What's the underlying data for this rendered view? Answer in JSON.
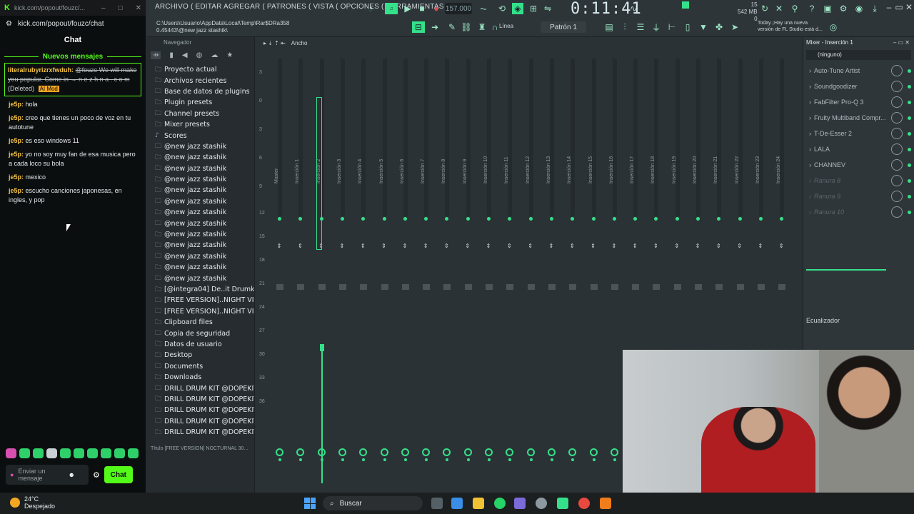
{
  "chat_window": {
    "url_title": "kick.com/popout/fouzc/...",
    "url": "kick.com/popout/fouzc/chat",
    "title": "Chat",
    "new_messages_label": "Nuevos mensajes",
    "deleted_message": {
      "user": "literalrubyrizrxfwduh:",
      "text": "@fouzc We will make you popular. Come in → n e z h n a . c o m",
      "deleted_label": "(Deleted)",
      "tag": "AI Mod"
    },
    "messages": [
      {
        "user": "je5p:",
        "text": "hola"
      },
      {
        "user": "je5p:",
        "text": "creo que tienes un poco de voz en tu autotune"
      },
      {
        "user": "je5p:",
        "text": "es eso windows 11"
      },
      {
        "user": "je5p:",
        "text": "yo no soy muy fan de esa musica pero a cada loco su bola"
      },
      {
        "user": "je5p:",
        "text": "mexico"
      },
      {
        "user": "je5p:",
        "text": "escucho canciones japonesas, en ingles, y pop"
      }
    ],
    "input_placeholder": "Enviar un mensaje",
    "send_button": "Chat"
  },
  "fl": {
    "menu": "ARCHIVO ( EDITAR AGREGAR ( PATRONES ( VISTA ( OPCIONES ( HERRAMIENTAS AYUD",
    "path_line1": "C:\\Users\\Usuario\\AppData\\Local\\Temp\\Rar$DRa358",
    "path_line2": "0.45443\\@new jazz stashik\\",
    "tempo": "157.000",
    "time": "0:11:41",
    "memory_top": "15",
    "memory_mb": "542 MB",
    "memory_bottom": "0",
    "news_line1": "Today  ¡Hay una nueva",
    "news_line2": "versión de FL Studio está d...",
    "pattern": "Patrón 1",
    "line_mode": "Línea",
    "accent_color": "#35e08a",
    "browser": {
      "title": "Navegador",
      "items": [
        {
          "icon": "folder-icon",
          "label": "Proyecto actual"
        },
        {
          "icon": "folder-icon",
          "label": "Archivos recientes"
        },
        {
          "icon": "folder-icon",
          "label": "Base de datos de plugins"
        },
        {
          "icon": "folder-icon",
          "label": "Plugin presets"
        },
        {
          "icon": "folder-icon",
          "label": "Channel presets"
        },
        {
          "icon": "folder-icon",
          "label": "Mixer presets"
        },
        {
          "icon": "note-icon",
          "label": "Scores"
        },
        {
          "icon": "folder-icon",
          "label": "@new jazz stashik"
        },
        {
          "icon": "folder-icon",
          "label": "@new jazz stashik"
        },
        {
          "icon": "folder-icon",
          "label": "@new jazz stashik"
        },
        {
          "icon": "folder-icon",
          "label": "@new jazz stashik"
        },
        {
          "icon": "folder-icon",
          "label": "@new jazz stashik"
        },
        {
          "icon": "folder-icon",
          "label": "@new jazz stashik"
        },
        {
          "icon": "folder-icon",
          "label": "@new jazz stashik"
        },
        {
          "icon": "folder-icon",
          "label": "@new jazz stashik"
        },
        {
          "icon": "folder-icon",
          "label": "@new jazz stashik"
        },
        {
          "icon": "folder-icon",
          "label": "@new jazz stashik"
        },
        {
          "icon": "folder-icon",
          "label": "@new jazz stashik"
        },
        {
          "icon": "folder-icon",
          "label": "@new jazz stashik"
        },
        {
          "icon": "folder-icon",
          "label": "@new jazz stashik"
        },
        {
          "icon": "folder-icon",
          "label": "[@integra04] De..it Drumkit 2023"
        },
        {
          "icon": "folder-icon",
          "label": "[FREE VERSION]..NIGHT VISION'"
        },
        {
          "icon": "folder-icon",
          "label": "[FREE VERSION]..NIGHT VISION'"
        },
        {
          "icon": "folder-icon",
          "label": "Clipboard files"
        },
        {
          "icon": "folder-icon",
          "label": "Copia de seguridad"
        },
        {
          "icon": "folder-icon",
          "label": "Datos de usuario"
        },
        {
          "icon": "folder-icon",
          "label": "Desktop"
        },
        {
          "icon": "folder-icon",
          "label": "Documents"
        },
        {
          "icon": "folder-icon",
          "label": "Downloads"
        },
        {
          "icon": "folder-icon",
          "label": "DRILL DRUM KIT @DOPEKIT"
        },
        {
          "icon": "folder-icon",
          "label": "DRILL DRUM KIT @DOPEKIT"
        },
        {
          "icon": "folder-icon",
          "label": "DRILL DRUM KIT @DOPEKIT"
        },
        {
          "icon": "folder-icon",
          "label": "DRILL DRUM KIT @DOPEKIT"
        },
        {
          "icon": "folder-icon",
          "label": "DRILL DRUM KIT @DOPEKIT"
        }
      ],
      "footer": "Título   [FREE VERSION] NOCTURNAL 30..."
    },
    "mixer": {
      "header": "Ancho",
      "scale": [
        "3",
        "0",
        "3",
        "6",
        "9",
        "12",
        "15",
        "18",
        "21",
        "24",
        "27",
        "30",
        "33",
        "36"
      ],
      "tracks": [
        "Master",
        "Inserción 1",
        "Inserción 2",
        "Inserción 3",
        "Inserción 4",
        "Inserción 5",
        "Inserción 6",
        "Inserción 7",
        "Inserción 8",
        "Inserción 9",
        "Inserción 10",
        "Inserción 11",
        "Inserción 12",
        "Inserción 13",
        "Inserción 14",
        "Inserción 15",
        "Inserción 16",
        "Inserción 17",
        "Inserción 18",
        "Inserción 19",
        "Inserción 20",
        "Inserción 21",
        "Inserción 22",
        "Inserción 23",
        "Inserción 24"
      ]
    },
    "insert_panel": {
      "title": "Mixer - Inserción 1",
      "input": "(ninguno)",
      "slots": [
        {
          "label": "Auto-Tune Artist",
          "active": true
        },
        {
          "label": "Soundgoodizer",
          "active": true
        },
        {
          "label": "FabFilter Pro-Q 3",
          "active": true
        },
        {
          "label": "Fruity Multiband Compr...",
          "active": true
        },
        {
          "label": "T-De-Esser 2",
          "active": true
        },
        {
          "label": "LALA",
          "active": true
        },
        {
          "label": "CHANNEV",
          "active": true
        },
        {
          "label": "Ranura 8",
          "active": false
        },
        {
          "label": "Ranura 9",
          "active": false
        },
        {
          "label": "Ranura 10",
          "active": false
        }
      ],
      "eq_label": "Ecualizador"
    }
  },
  "taskbar": {
    "temp": "24°C",
    "weather": "Despejado",
    "search": "Buscar"
  }
}
